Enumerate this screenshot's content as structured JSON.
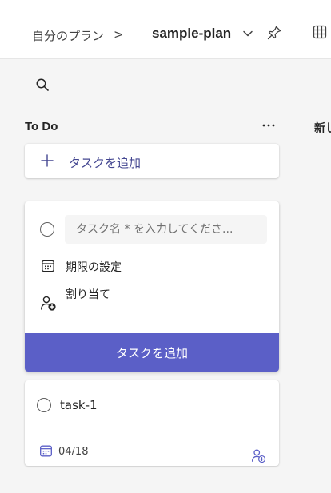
{
  "header": {
    "breadcrumb_label": "自分のプラン",
    "breadcrumb_separator": ">",
    "plan_name": "sample-plan",
    "icons": [
      "chevron-down-icon",
      "pin-icon",
      "grid-view-icon"
    ]
  },
  "toolbar": {
    "icons": [
      "search-icon"
    ]
  },
  "bucket": {
    "title": "To Do",
    "more_icon": "more-horizontal-icon",
    "add_task_label": "タスクを追加"
  },
  "next_bucket": {
    "title_partial": "新し"
  },
  "new_task_form": {
    "name_placeholder": "タスク名 * を入力してくださ...",
    "due_label": "期限の設定",
    "assign_label": "割り当て",
    "submit_label": "タスクを追加"
  },
  "tasks": [
    {
      "title": "task-1",
      "due_date": "04/18",
      "icons": [
        "circle-checkbox-icon",
        "calendar-icon",
        "assign-person-icon"
      ]
    }
  ],
  "colors": {
    "accent": "#5b5fc7",
    "accent_text": "#444791",
    "background": "#f5f5f5",
    "card": "#ffffff"
  }
}
